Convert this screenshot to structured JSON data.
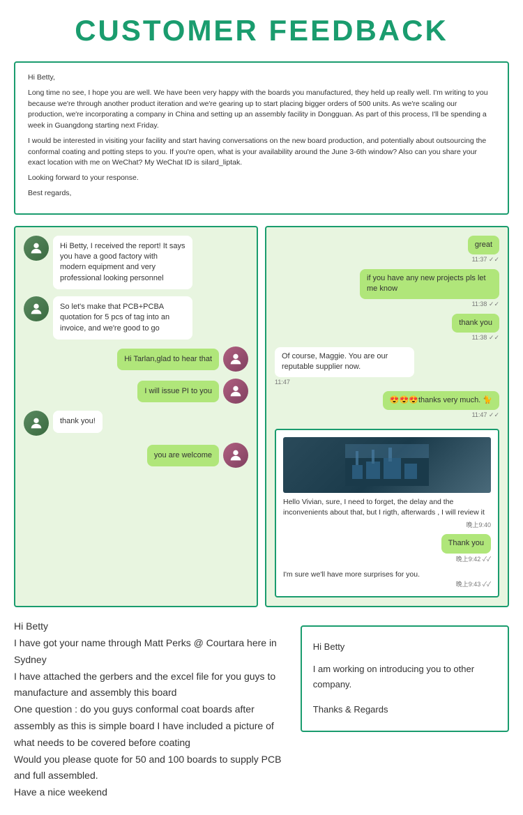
{
  "page": {
    "title": "CUSTOMER FEEDBACK"
  },
  "email1": {
    "greeting": "Hi Betty,",
    "body1": "Long time no see, I hope you are well. We have been very happy with the boards you manufactured, they held up really well. I'm writing to you because we're through another product iteration and we're gearing up to start placing bigger orders of 500 units. As we're scaling our production, we're incorporating a company in China and setting up an assembly facility in Dongguan. As part of this process, I'll be spending a week in Guangdong starting next Friday.",
    "body2": "I would be interested in visiting your facility and start having conversations on the new board production, and potentially about outsourcing the conformal coating and potting steps to you. If you're open, what is your availability around the June 3-6th window? Also can you share your exact location with me on WeChat? My WeChat ID is silard_liptak.",
    "body3": "Looking forward to your response.",
    "sign": "Best regards,"
  },
  "chat_left": {
    "msg1": "Hi Betty, I received the report! It says you have a good factory with modern equipment and very professional looking personnel",
    "msg2": "So let's make that PCB+PCBA quotation for 5 pcs of tag into an invoice, and we're good to go",
    "msg3_bubble": "Hi Tarlan,glad to hear that",
    "msg4_bubble": "I will issue PI to you",
    "msg5": "thank you!",
    "msg6_bubble": "you are welcome"
  },
  "chat_right_top": {
    "msg1": "great",
    "time1": "11:37 ✓✓",
    "msg2": "if you have any new projects pls let me know",
    "time2": "11:38 ✓✓",
    "msg3": "thank you",
    "time3": "11:38 ✓✓",
    "msg4": "Of course, Maggie. You are our reputable supplier now.",
    "time4": "11:47",
    "msg5": "😍😍😍thanks very much. 🐈",
    "time5": "11:47 ✓✓"
  },
  "chat_right_bottom": {
    "msg1": "Hello Vivian, sure, I need to forget, the delay and the inconvenients about that, but I rigth, afterwards , I will review it",
    "time1": "晚上9:40",
    "msg2": "Thank you",
    "time2": "晚上9:42 ✓✓",
    "msg3": "I'm sure we'll have more surprises for you.",
    "time3": "晚上9:43 ✓✓"
  },
  "email2": {
    "line1": "Hi Betty",
    "line2": "I have got your name through Matt Perks @ Courtara here in Sydney",
    "line3": "I have attached the gerbers and the excel file for you guys to manufacture and assembly this board",
    "line4": "One question : do you guys conformal coat boards after assembly as this is simple board I have included a picture of what needs to be covered before coating",
    "line5": "Would you please quote for 50 and 100 boards to supply PCB and full assembled.",
    "line6": "Have a nice weekend"
  },
  "email3": {
    "line1": "Hi Betty",
    "line2": "I am working on introducing you to other company.",
    "line3": "Thanks & Regards"
  }
}
